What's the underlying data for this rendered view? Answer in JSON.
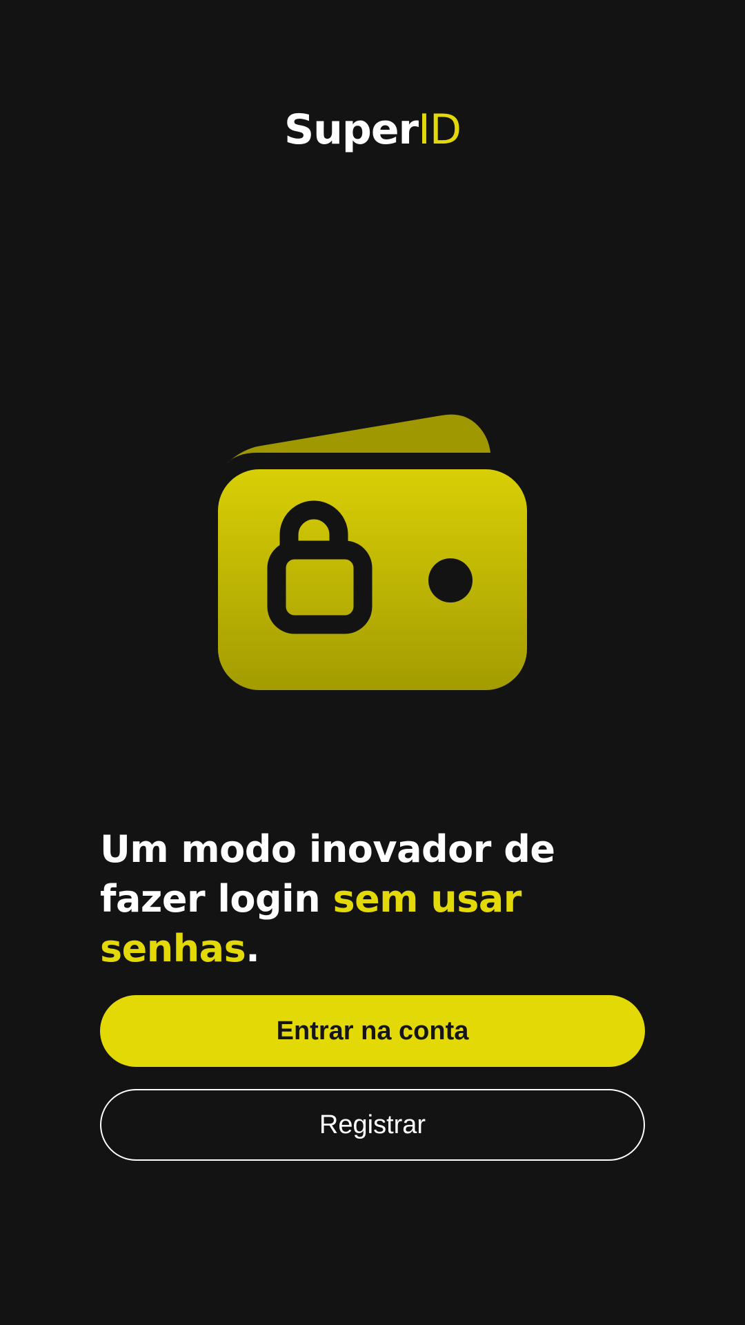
{
  "logo": {
    "part1": "Super",
    "part2": "ID"
  },
  "illustration": {
    "icon": "wallet-lock-icon"
  },
  "headline": {
    "text_before": "Um modo inovador de fazer login ",
    "highlight": "sem usar senhas",
    "text_after": "."
  },
  "buttons": {
    "login_label": "Entrar na conta",
    "register_label": "Registrar"
  },
  "colors": {
    "background": "#131313",
    "accent": "#e2d907",
    "text": "#ffffff"
  }
}
